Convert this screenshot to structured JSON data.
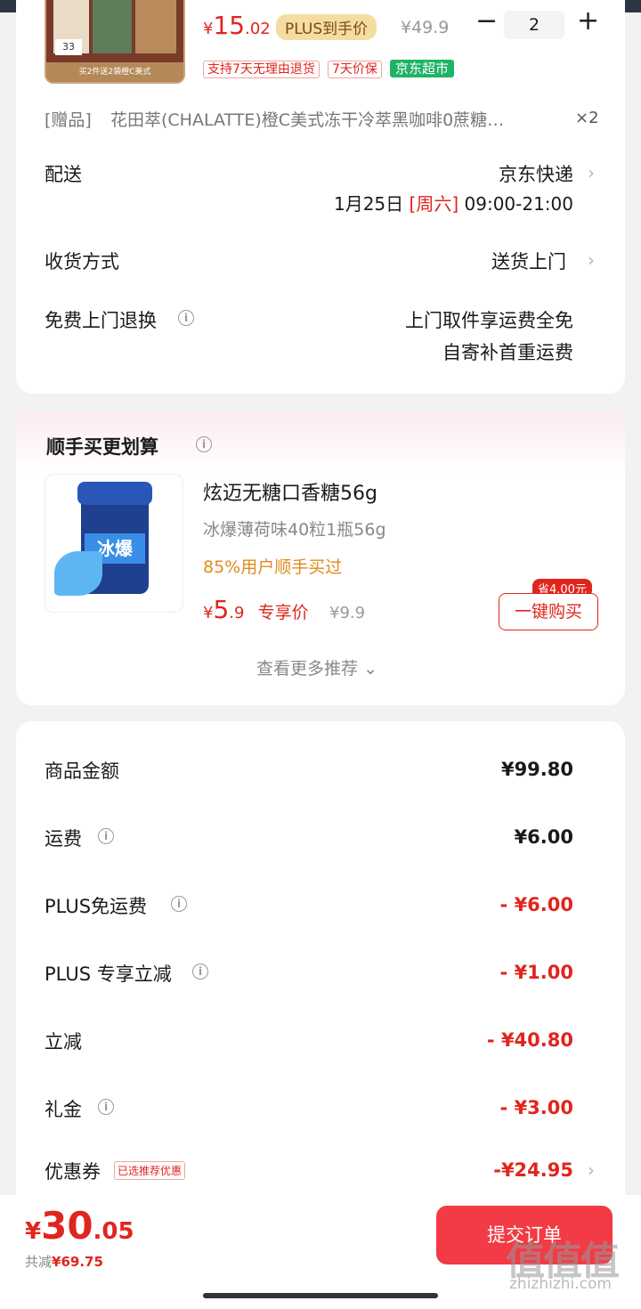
{
  "product": {
    "thumb_price": "33",
    "thumb_strip": "买2件送2袋橙C美式",
    "price_symbol": "¥",
    "price_int": "15",
    "price_dec": ".02",
    "plus_badge": "PLUS到手价",
    "orig_price": "¥49.9",
    "quantity": "2",
    "minus": "−",
    "plus": "+",
    "tags": [
      "支持7天无理由退货",
      "7天价保"
    ],
    "tag_store": "京东超市"
  },
  "gift": {
    "label": "[赠品]",
    "name": "花田萃(CHALATTE)橙C美式冻干冷萃黑咖啡0蔗糖…",
    "qty": "×2"
  },
  "delivery": {
    "label": "配送",
    "carrier": "京东快递",
    "date": "1月25日",
    "weekday": "[周六]",
    "time": "09:00-21:00"
  },
  "receive": {
    "label": "收货方式",
    "value": "送货上门"
  },
  "returns": {
    "label": "免费上门退换",
    "line1": "上门取件享运费全免",
    "line2": "自寄补首重运费"
  },
  "recommend": {
    "title": "顺手买更划算",
    "name": "炫迈无糖口香糖56g",
    "spec": "冰爆薄荷味40粒1瓶56g",
    "stat": "85%用户顺手买过",
    "price_int": "5",
    "price_dec": ".9",
    "price_label": "专享价",
    "orig_price": "¥9.9",
    "save": "省4.00元",
    "buy": "一键购买",
    "more": "查看更多推荐",
    "jar_text": "冰爆"
  },
  "summary": {
    "rows": [
      {
        "label": "商品金额",
        "value": "¥99.80"
      },
      {
        "label": "运费",
        "value": "¥6.00"
      },
      {
        "label": "PLUS免运费",
        "value": "- ¥6.00"
      },
      {
        "label": "PLUS 专享立减",
        "value": "- ¥1.00"
      },
      {
        "label": "立减",
        "value": "- ¥40.80"
      },
      {
        "label": "礼金",
        "value": "- ¥3.00"
      },
      {
        "label": "优惠券",
        "value": "-¥24.95"
      }
    ],
    "coupon_tag": "已选推荐优惠"
  },
  "footer": {
    "currency": "¥",
    "total_int": "30",
    "total_dec": ".05",
    "saved_label": "共减",
    "saved_value": "¥69.75",
    "submit": "提交订单"
  },
  "watermark": {
    "main": "值值值",
    "sub": "zhizhizhi.com"
  },
  "colors": {
    "accent": "#e0251d",
    "submit": "#f23b45",
    "store_tag": "#1fb366",
    "plus_badge": "#f5dca0"
  }
}
